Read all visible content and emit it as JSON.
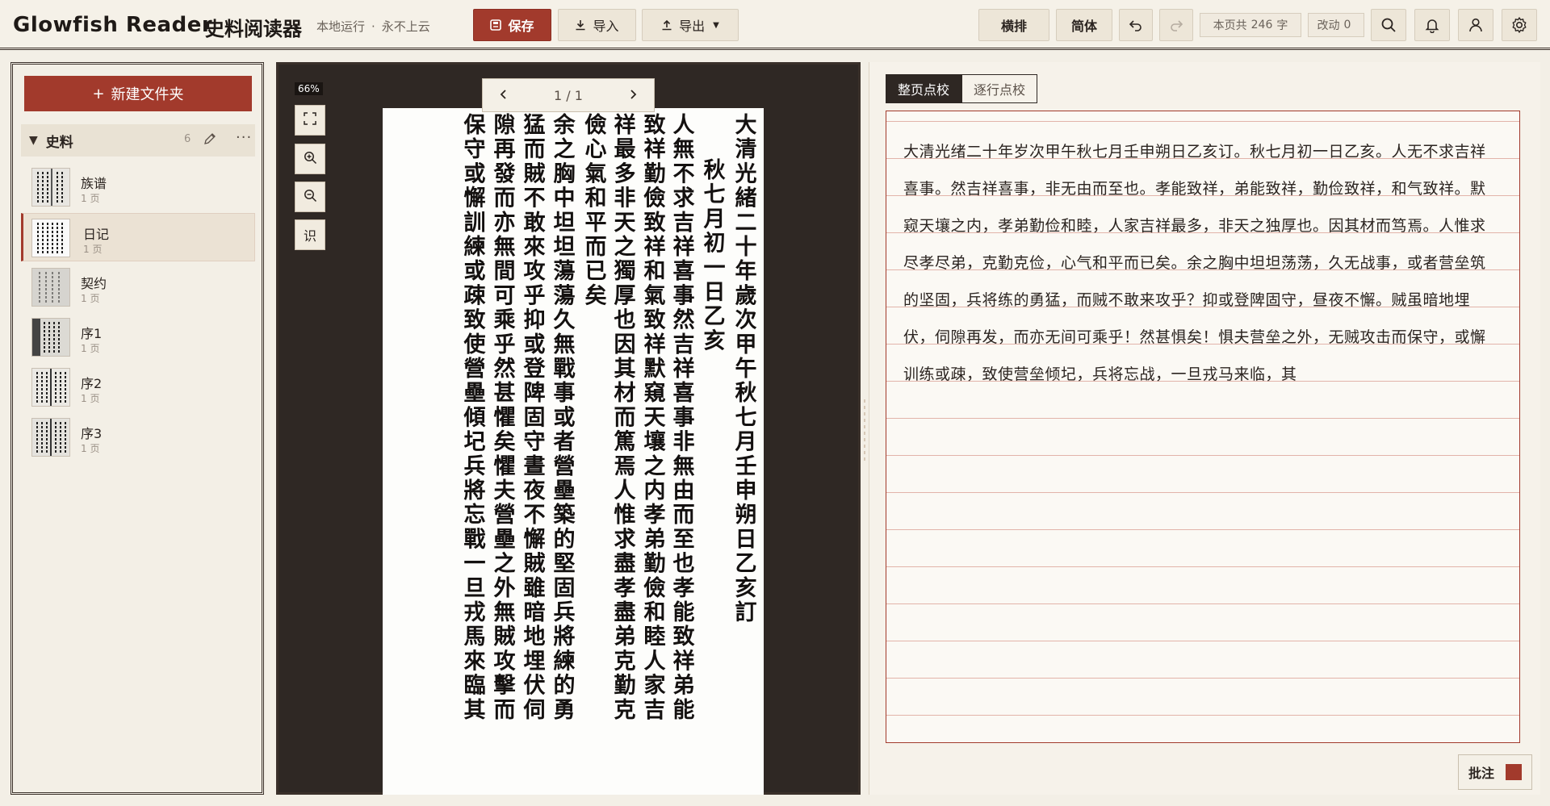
{
  "header": {
    "brand": "Glowfish Reader",
    "brand_cn": "史料阅读器",
    "tagline_left": "本地运行",
    "tagline_sep": "·",
    "tagline_right": "永不上云",
    "save_label": "保存",
    "import_label": "导入",
    "export_label": "导出",
    "horizontal_label": "横排",
    "simplified_label": "简体",
    "char_count_prefix": "本页共",
    "char_count": "246",
    "char_count_suffix": "字",
    "edits_label": "改动",
    "edits_count": "0",
    "accent_color": "#a23a2c"
  },
  "sidebar": {
    "new_folder_label": "新建文件夹",
    "folder": {
      "name": "史料",
      "count": "6"
    },
    "documents": [
      {
        "title": "族谱",
        "pages": "1 页"
      },
      {
        "title": "日记",
        "pages": "1 页",
        "active": true
      },
      {
        "title": "契约",
        "pages": "1 页"
      },
      {
        "title": "序1",
        "pages": "1 页"
      },
      {
        "title": "序2",
        "pages": "1 页"
      },
      {
        "title": "序3",
        "pages": "1 页"
      }
    ]
  },
  "viewer": {
    "zoom": "66%",
    "tool_ocr_label": "识",
    "page_indicator": "1 / 1",
    "columns": [
      "大清光緒二十年歲次甲午秋七月壬申朔日乙亥訂",
      "秋七月初一日乙亥",
      "人無不求吉祥喜事然吉祥喜事非無由而至也孝能致祥弟能",
      "致祥勤儉致祥和氣致祥默窺天壤之内孝弟勤儉和睦人家吉",
      "祥最多非天之獨厚也因其材而篤焉人惟求盡孝盡弟克勤克",
      "儉心氣和平而已矣",
      "余之胸中坦坦蕩蕩久無戰事或者營壘築的堅固兵將練的勇",
      "猛而賊不敢來攻乎抑或登陴固守晝夜不懈賊雖暗地埋伏伺",
      "隙再發而亦無間可乘乎然甚懼矣懼夫營壘之外無賊攻擊而",
      "保守或懈訓練或疎致使營壘傾圮兵將忘戰一旦戎馬來臨其"
    ]
  },
  "editor": {
    "tab_page": "整页点校",
    "tab_line": "逐行点校",
    "text": "大清光绪二十年岁次甲午秋七月壬申朔日乙亥订。秋七月初一日乙亥。人无不求吉祥喜事。然吉祥喜事，非无由而至也。孝能致祥，弟能致祥，勤俭致祥，和气致祥。默窥天壤之内，孝弟勤俭和睦，人家吉祥最多，非天之独厚也。因其材而笃焉。人惟求尽孝尽弟，克勤克俭，心气和平而已矣。余之胸中坦坦荡荡，久无战事，或者营垒筑的坚固，兵将练的勇猛，而贼不敢来攻乎？抑或登陴固守，昼夜不懈。贼虽暗地埋伏，伺隙再发，而亦无间可乘乎！然甚惧矣！惧夫营垒之外，无贼攻击而保守，或懈训练或疎，致使营垒倾圮，兵将忘战，一旦戎马来临，其",
    "annotate_label": "批注"
  }
}
